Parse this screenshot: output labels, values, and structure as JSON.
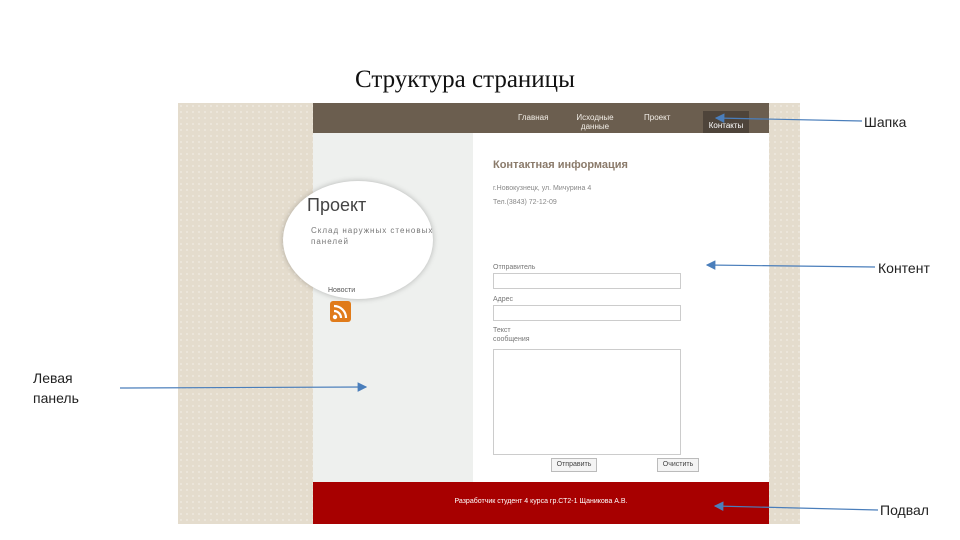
{
  "slide_title": "Структура страницы",
  "website": {
    "nav": [
      "Главная",
      "Исходные данные",
      "Проект"
    ],
    "nav_active": "Контакты",
    "logo_title": "Проект",
    "logo_subtitle": "Склад наружных стеновых панелей",
    "news_label": "Новости",
    "contact_title": "Контактная информация",
    "address": "г.Новокузнецк, ул. Мичурина 4",
    "phone": "Тел.(3843) 72-12-09",
    "field_sender": "Отправитель",
    "field_address": "Адрес",
    "field_message": "Текст сообщения",
    "btn_send": "Отправить",
    "btn_clear": "Очистить",
    "footer_text": "Разработчик студент 4 курса гр.СТ2-1 Щаникова А.В."
  },
  "annotations": {
    "header": "Шапка",
    "content": "Контент",
    "left_panel": "Левая панель",
    "footer": "Подвал"
  },
  "colors": {
    "header": "#6b5e4f",
    "footer": "#a70000",
    "background": "#e4dccd",
    "arrow": "#4a7ebb"
  }
}
